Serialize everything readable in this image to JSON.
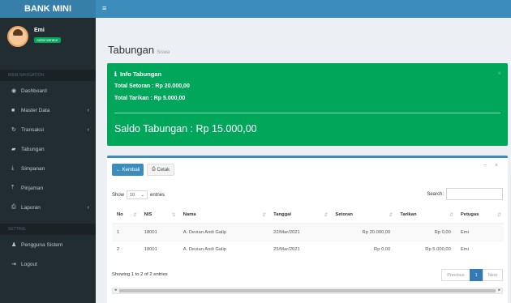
{
  "app": {
    "brand": "BANK MINI",
    "toggle_icon": "≡"
  },
  "user": {
    "name": "Emi",
    "role": "Administrator"
  },
  "sidebar": {
    "nav_header": "MAIN NAVIGATION",
    "setting_header": "SETTING",
    "items": [
      {
        "label": "Dashboard",
        "icon": "dashboard-icon",
        "glyph": "◉",
        "submenu": false
      },
      {
        "label": "Master Data",
        "icon": "book-icon",
        "glyph": "■",
        "submenu": true
      },
      {
        "label": "Transaksi",
        "icon": "refresh-icon",
        "glyph": "↻",
        "submenu": true
      },
      {
        "label": "Tabungan",
        "icon": "wallet-icon",
        "glyph": "▰",
        "submenu": false
      },
      {
        "label": "Simpanan",
        "icon": "download-icon",
        "glyph": "⤓",
        "submenu": false
      },
      {
        "label": "Pinjaman",
        "icon": "upload-icon",
        "glyph": "⤒",
        "submenu": false
      },
      {
        "label": "Laporan",
        "icon": "print-icon",
        "glyph": "⎙",
        "submenu": true
      }
    ],
    "setting_items": [
      {
        "label": "Pengguna Sistem",
        "icon": "user-icon",
        "glyph": "♟"
      },
      {
        "label": "Logout",
        "icon": "logout-icon",
        "glyph": "⇥"
      }
    ]
  },
  "page": {
    "title": "Tabungan",
    "subtitle": "Siswa"
  },
  "info": {
    "heading": "Info Tabungan",
    "setoran": "Total Setoran : Rp 20.000,00",
    "tarikan": "Total Tarikan : Rp 5.000,00",
    "saldo": "Saldo Tabungan : Rp 15.000,00",
    "close": "×"
  },
  "toolbar": {
    "back_label": "Kembali",
    "print_label": "Cetak",
    "tools": "− ×"
  },
  "table_controls": {
    "show_label": "Show",
    "entries_value": "10",
    "entries_label": "entries",
    "search_label": "Search:"
  },
  "table": {
    "headers": [
      "No",
      "NIS",
      "Nama",
      "Tanggal",
      "Setoran",
      "Tarikan",
      "Petugas"
    ],
    "rows": [
      [
        "1",
        "18001",
        "A. Devian Andi Galip",
        "22/Mar/2021",
        "Rp 20.000,00",
        "Rp 0,00",
        "Emi"
      ],
      [
        "2",
        "18001",
        "A. Devian Andi Galip",
        "25/Mar/2021",
        "Rp 0,00",
        "Rp 5.000,00",
        "Emi"
      ]
    ]
  },
  "footer": {
    "showing": "Showing 1 to 2 of 2 entries",
    "previous": "Previous",
    "page": "1",
    "next": "Next"
  },
  "colors": {
    "primary": "#3c8dbc",
    "success": "#00a65a",
    "sidebar": "#222d32"
  }
}
